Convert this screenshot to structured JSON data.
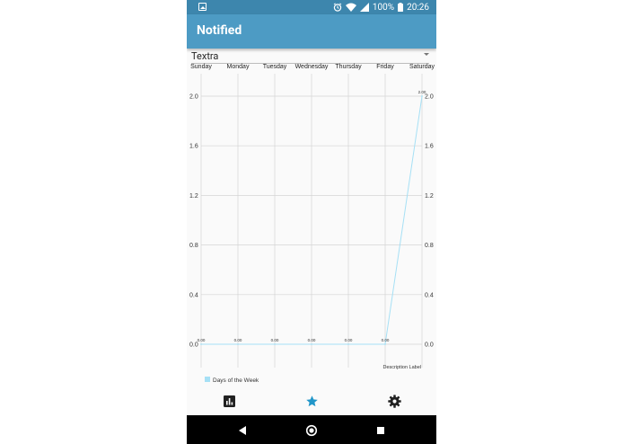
{
  "status_bar": {
    "battery_percent": "100%",
    "time": "20:26",
    "left_icon": "image-notification-icon",
    "right_icons": [
      "alarm-icon",
      "wifi-icon",
      "cell-signal-icon",
      "battery-icon"
    ]
  },
  "app_bar": {
    "title": "Notified",
    "color": "#4d9bc4"
  },
  "app_selector": {
    "selected": "Textra"
  },
  "chart_data": {
    "type": "line",
    "categories": [
      "Sunday",
      "Monday",
      "Tuesday",
      "Wednesday",
      "Thursday",
      "Friday",
      "Saturday"
    ],
    "series": [
      {
        "name": "Days of the Week",
        "values": [
          0,
          0,
          0,
          0,
          0,
          0,
          2
        ],
        "value_labels": [
          "0.00",
          "0.00",
          "0.00",
          "0.00",
          "0.00",
          "0.00",
          "2.00"
        ],
        "color": "#a6e0f5"
      }
    ],
    "ylim": [
      0,
      2
    ],
    "yticks": [
      "0.0",
      "0.4",
      "0.8",
      "1.2",
      "1.6",
      "2.0"
    ],
    "grid": true,
    "legend": "bottom-left",
    "description": "Description Label"
  },
  "bottom_nav": {
    "items": [
      "bar-chart-icon",
      "star-icon",
      "settings-gear-icon"
    ],
    "active_color": "#2196c9"
  },
  "system_nav": {
    "items": [
      "back-icon",
      "home-icon",
      "recents-icon"
    ]
  }
}
